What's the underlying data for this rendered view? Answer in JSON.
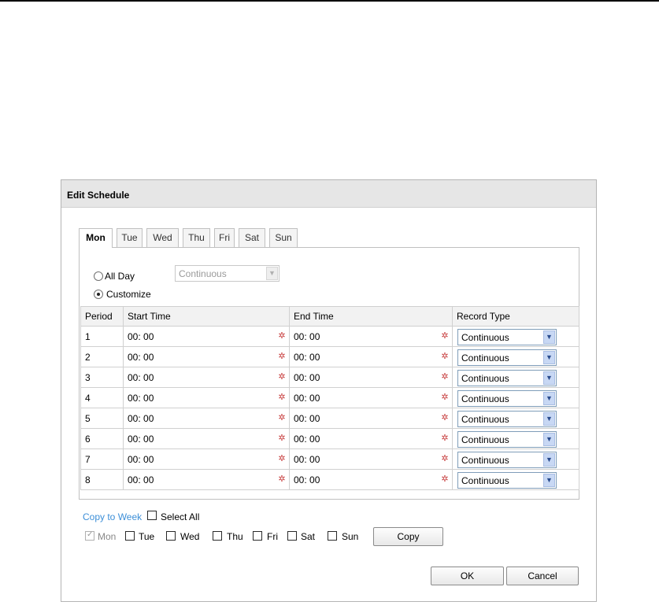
{
  "dialog": {
    "title": "Edit Schedule"
  },
  "tabs": [
    "Mon",
    "Tue",
    "Wed",
    "Thu",
    "Fri",
    "Sat",
    "Sun"
  ],
  "mode": {
    "all_day_label": "All Day",
    "all_day_type": "Continuous",
    "customize_label": "Customize",
    "selected": "Customize"
  },
  "table": {
    "headers": [
      "Period",
      "Start Time",
      "End Time",
      "Record Type"
    ],
    "rows": [
      {
        "period": "1",
        "start": "00: 00",
        "end": "00: 00",
        "type": "Continuous"
      },
      {
        "period": "2",
        "start": "00: 00",
        "end": "00: 00",
        "type": "Continuous"
      },
      {
        "period": "3",
        "start": "00: 00",
        "end": "00: 00",
        "type": "Continuous"
      },
      {
        "period": "4",
        "start": "00: 00",
        "end": "00: 00",
        "type": "Continuous"
      },
      {
        "period": "5",
        "start": "00: 00",
        "end": "00: 00",
        "type": "Continuous"
      },
      {
        "period": "6",
        "start": "00: 00",
        "end": "00: 00",
        "type": "Continuous"
      },
      {
        "period": "7",
        "start": "00: 00",
        "end": "00: 00",
        "type": "Continuous"
      },
      {
        "period": "8",
        "start": "00: 00",
        "end": "00: 00",
        "type": "Continuous"
      }
    ]
  },
  "copy": {
    "copy_to_week": "Copy to Week",
    "select_all": "Select All",
    "days": [
      "Mon",
      "Tue",
      "Wed",
      "Thu",
      "Fri",
      "Sat",
      "Sun"
    ],
    "copy_button": "Copy"
  },
  "buttons": {
    "ok": "OK",
    "cancel": "Cancel"
  },
  "icons": {
    "time_picker": "clock-icon",
    "dropdown": "chevron-down-icon"
  },
  "colors": {
    "link": "#3d8fd8",
    "header_bg": "#e6e6e6",
    "combo_border": "#7f9db9"
  }
}
